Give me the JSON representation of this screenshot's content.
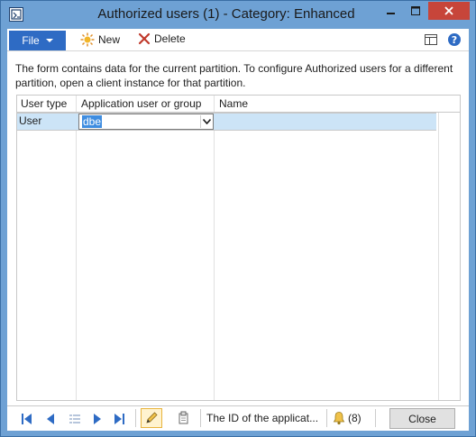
{
  "window": {
    "title": "Authorized users (1) - Category: Enhanced",
    "colors": {
      "frame": "#6ea1d4",
      "close_button": "#c7453a",
      "file_button": "#2e6bc4",
      "selected_row": "#cce4f7",
      "selection_highlight": "#3f8de0"
    }
  },
  "ribbon": {
    "file_label": "File",
    "new_label": "New",
    "delete_label": "Delete"
  },
  "info_message": "The form contains data for the current partition. To configure Authorized users for a different partition, open a client instance for that partition.",
  "grid": {
    "columns": [
      "User type",
      "Application user or group",
      "Name"
    ],
    "rows": [
      {
        "user_type": "User",
        "application_user_or_group": "dbe",
        "name": ""
      }
    ]
  },
  "statusbar": {
    "field_help": "The ID of the applicat...",
    "notification_count": "(8)",
    "close_label": "Close"
  },
  "icons": {
    "app": "form-icon",
    "new": "sun-new-icon",
    "delete": "x-delete-icon",
    "layout": "layout-icon",
    "help": "help-icon",
    "nav": [
      "first-record-icon",
      "previous-record-icon",
      "list-grid-icon",
      "next-record-icon",
      "last-record-icon"
    ],
    "edit": "pencil-edit-icon",
    "attach": "attachment-icon",
    "bell": "bell-icon"
  }
}
